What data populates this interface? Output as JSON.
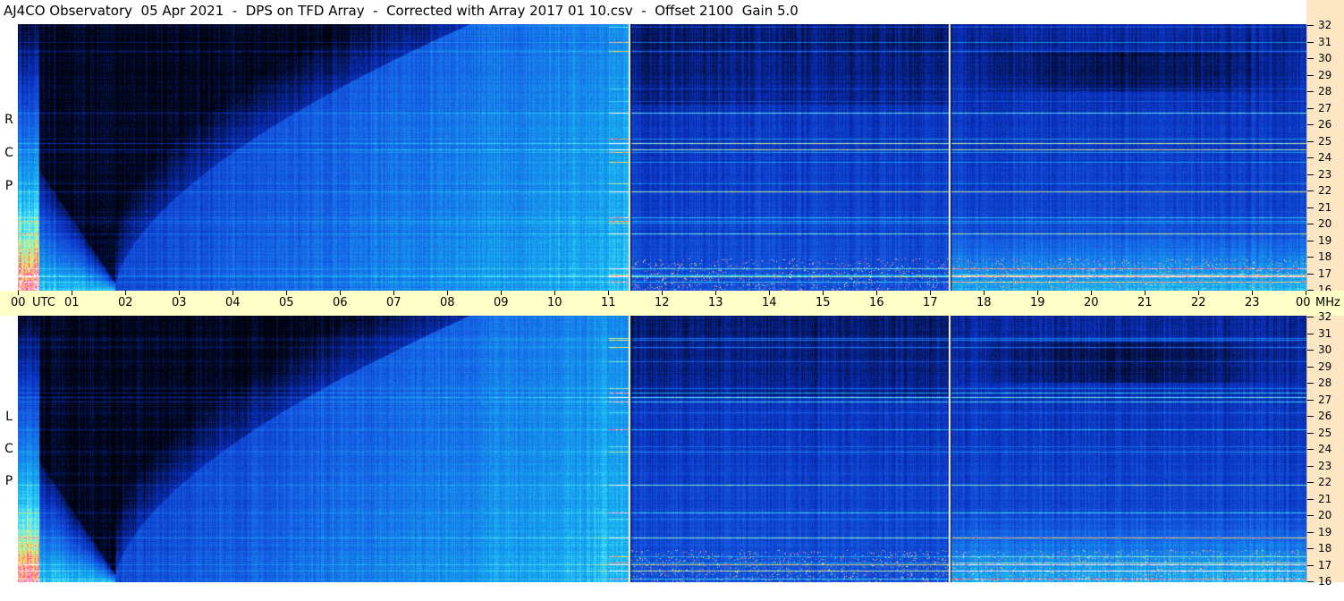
{
  "title": "AJ4CO Observatory  05 Apr 2021  -  DPS on TFD Array  -  Corrected with Array 2017 01 10.csv  -  Offset 2100  Gain 5.0",
  "chart_data": [
    {
      "type": "heatmap",
      "panel": "RCP",
      "polarization_label": [
        "R",
        "C",
        "P"
      ],
      "x_axis": {
        "unit_label": "UTC",
        "tick_labels": [
          "00",
          "01",
          "02",
          "03",
          "04",
          "05",
          "06",
          "07",
          "08",
          "09",
          "10",
          "11",
          "12",
          "13",
          "14",
          "15",
          "16",
          "17",
          "18",
          "19",
          "20",
          "21",
          "22",
          "23",
          "00"
        ],
        "range_hours": [
          0,
          24
        ]
      },
      "y_axis": {
        "unit_label": "MHz",
        "tick_labels": [
          "16",
          "17",
          "18",
          "19",
          "20",
          "21",
          "22",
          "23",
          "24",
          "25",
          "26",
          "27",
          "28",
          "29",
          "30",
          "31",
          "32"
        ],
        "range": [
          16,
          32
        ]
      },
      "colormap": [
        "#00020a",
        "#0a2fbd",
        "#1660e6",
        "#16b2f0",
        "#5ef0ff",
        "#fff04a",
        "#ff3ca0",
        "#ffffff"
      ],
      "vertical_lines_hours": [
        11.38,
        17.35
      ]
    },
    {
      "type": "heatmap",
      "panel": "LCP",
      "polarization_label": [
        "L",
        "C",
        "P"
      ],
      "x_axis": {
        "unit_label": "UTC",
        "tick_labels": [
          "00",
          "01",
          "02",
          "03",
          "04",
          "05",
          "06",
          "07",
          "08",
          "09",
          "10",
          "11",
          "12",
          "13",
          "14",
          "15",
          "16",
          "17",
          "18",
          "19",
          "20",
          "21",
          "22",
          "23",
          "00"
        ],
        "range_hours": [
          0,
          24
        ]
      },
      "y_axis": {
        "unit_label": "MHz",
        "tick_labels": [
          "16",
          "17",
          "18",
          "19",
          "20",
          "21",
          "22",
          "23",
          "24",
          "25",
          "26",
          "27",
          "28",
          "29",
          "30",
          "31",
          "32"
        ],
        "range": [
          16,
          32
        ]
      },
      "colormap": [
        "#00020a",
        "#0a2fbd",
        "#1660e6",
        "#16b2f0",
        "#5ef0ff",
        "#fff04a",
        "#ff3ca0",
        "#ffffff"
      ],
      "vertical_lines_hours": [
        11.38,
        17.35
      ]
    }
  ]
}
